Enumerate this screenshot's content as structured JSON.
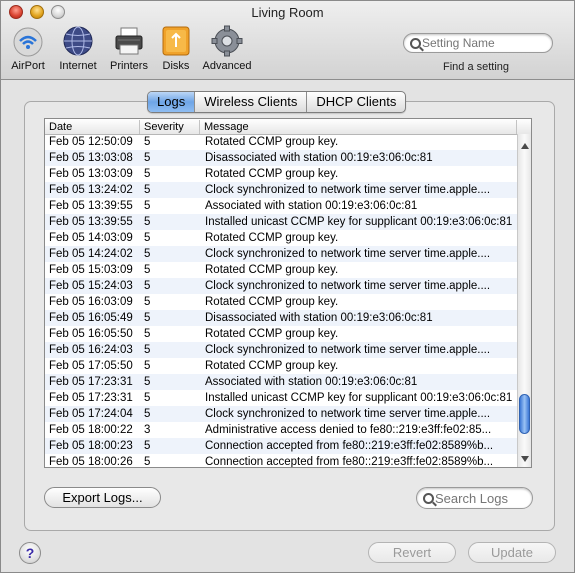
{
  "window": {
    "title": "Living Room"
  },
  "toolbar": {
    "items": [
      {
        "label": "AirPort",
        "icon": "airport-icon"
      },
      {
        "label": "Internet",
        "icon": "globe-icon"
      },
      {
        "label": "Printers",
        "icon": "printer-icon"
      },
      {
        "label": "Disks",
        "icon": "disk-icon"
      },
      {
        "label": "Advanced",
        "icon": "gear-icon"
      }
    ],
    "search_placeholder": "Setting Name",
    "find_label": "Find a setting"
  },
  "tabs": [
    {
      "label": "Logs",
      "active": true
    },
    {
      "label": "Wireless Clients",
      "active": false
    },
    {
      "label": "DHCP Clients",
      "active": false
    }
  ],
  "table": {
    "columns": [
      "Date",
      "Severity",
      "Message"
    ],
    "rows": [
      [
        "Feb 05 12:50:09",
        "5",
        "Rotated CCMP group key."
      ],
      [
        "Feb 05 13:03:08",
        "5",
        "Disassociated with station 00:19:e3:06:0c:81"
      ],
      [
        "Feb 05 13:03:09",
        "5",
        "Rotated CCMP group key."
      ],
      [
        "Feb 05 13:24:02",
        "5",
        "Clock synchronized to network time server time.apple...."
      ],
      [
        "Feb 05 13:39:55",
        "5",
        "Associated with station 00:19:e3:06:0c:81"
      ],
      [
        "Feb 05 13:39:55",
        "5",
        "Installed unicast CCMP key for supplicant 00:19:e3:06:0c:81"
      ],
      [
        "Feb 05 14:03:09",
        "5",
        "Rotated CCMP group key."
      ],
      [
        "Feb 05 14:24:02",
        "5",
        "Clock synchronized to network time server time.apple...."
      ],
      [
        "Feb 05 15:03:09",
        "5",
        "Rotated CCMP group key."
      ],
      [
        "Feb 05 15:24:03",
        "5",
        "Clock synchronized to network time server time.apple...."
      ],
      [
        "Feb 05 16:03:09",
        "5",
        "Rotated CCMP group key."
      ],
      [
        "Feb 05 16:05:49",
        "5",
        "Disassociated with station 00:19:e3:06:0c:81"
      ],
      [
        "Feb 05 16:05:50",
        "5",
        "Rotated CCMP group key."
      ],
      [
        "Feb 05 16:24:03",
        "5",
        "Clock synchronized to network time server time.apple...."
      ],
      [
        "Feb 05 17:05:50",
        "5",
        "Rotated CCMP group key."
      ],
      [
        "Feb 05 17:23:31",
        "5",
        "Associated with station 00:19:e3:06:0c:81"
      ],
      [
        "Feb 05 17:23:31",
        "5",
        "Installed unicast CCMP key for supplicant 00:19:e3:06:0c:81"
      ],
      [
        "Feb 05 17:24:04",
        "5",
        "Clock synchronized to network time server time.apple...."
      ],
      [
        "Feb 05 18:00:22",
        "3",
        "Administrative access denied to fe80::219:e3ff:fe02:85..."
      ],
      [
        "Feb 05 18:00:23",
        "5",
        "Connection accepted from fe80::219:e3ff:fe02:8589%b..."
      ],
      [
        "Feb 05 18:00:26",
        "5",
        "Connection accepted from fe80::219:e3ff:fe02:8589%b..."
      ]
    ]
  },
  "buttons": {
    "export": "Export Logs...",
    "revert": "Revert",
    "update": "Update",
    "help": "?"
  },
  "search_logs_placeholder": "Search Logs",
  "colors": {
    "tab_active": "#6ea5e6",
    "scroll_thumb": "#3d78d6"
  }
}
